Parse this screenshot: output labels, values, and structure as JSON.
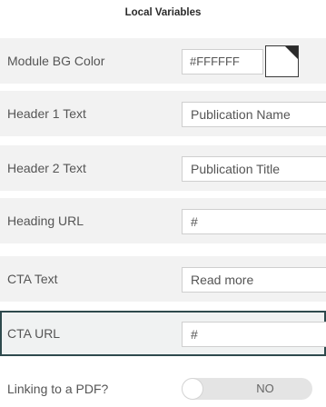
{
  "panel": {
    "title": "Local Variables"
  },
  "fields": {
    "module_bg_color": {
      "label": "Module BG Color",
      "value": "#FFFFFF",
      "swatch_color": "#FFFFFF"
    },
    "header1_text": {
      "label": "Header 1 Text",
      "value": "Publication Name"
    },
    "header2_text": {
      "label": "Header 2 Text",
      "value": "Publication Title"
    },
    "heading_url": {
      "label": "Heading URL",
      "value": "#"
    },
    "cta_text": {
      "label": "CTA Text",
      "value": "Read more"
    },
    "cta_url": {
      "label": "CTA URL",
      "value": "#"
    },
    "linking_pdf": {
      "label": "Linking to a PDF?",
      "state": "NO"
    }
  },
  "colors": {
    "row_background": "#f2f2f2",
    "selected_border": "#2e4a4d",
    "toggle_track": "#e4e4e4"
  }
}
